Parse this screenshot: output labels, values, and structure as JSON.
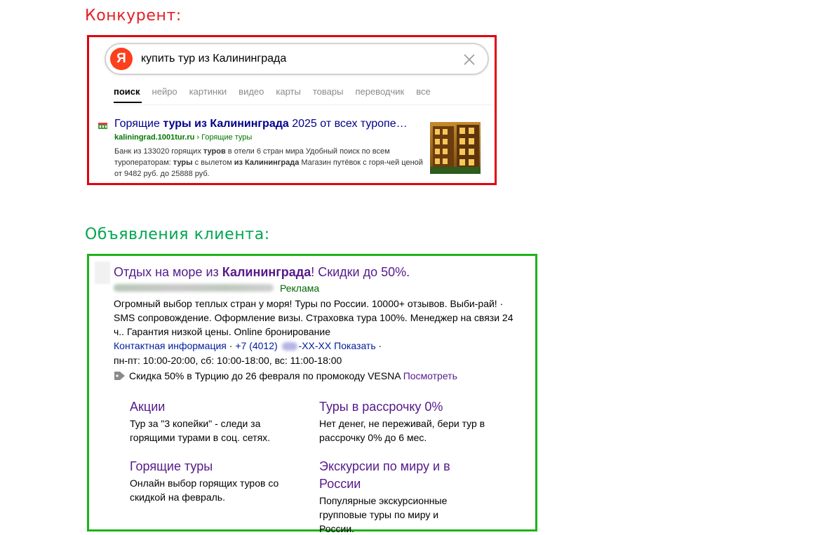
{
  "headings": {
    "competitor": "Конкурент:",
    "client": "Объявления клиента:"
  },
  "competitor": {
    "search": {
      "logo": "Я",
      "query": "купить тур из Калининграда"
    },
    "tabs": [
      "поиск",
      "нейро",
      "картинки",
      "видео",
      "карты",
      "товары",
      "переводчик",
      "все"
    ],
    "result": {
      "title_pre": "Горящие ",
      "title_bold": "туры из Калининграда",
      "title_post": " 2025 от всех туропе…",
      "url_domain": "kaliningrad.1001tur.ru",
      "url_path": " › Горящие туры",
      "desc_1": "Банк из 133020 горящих ",
      "desc_b1": "туров",
      "desc_2": " в отели 6 стран мира Удобный поиск по всем туроператорам: ",
      "desc_b2": "туры",
      "desc_3": " с вылетом ",
      "desc_b3": "из Калининграда",
      "desc_4": " Магазин путёвок с горя-чей ценой от 9482 руб. до 25888 руб."
    }
  },
  "client_ad": {
    "title_pre": "Отдых на море из ",
    "title_bold": "Калининграда",
    "title_post": "! Скидки до 50%.",
    "label": "Реклама",
    "description": "Огромный выбор теплых стран у моря! Туры по России. 10000+ отзывов. Выби-рай! · SMS сопровождение. Оформление визы. Страховка тура 100%. Менеджер на связи 24 ч.. Гарантия низкой цены. Online бронирование",
    "contacts": {
      "contact_info": "Контактная информация",
      "sep": " · ",
      "phone_start": "+7 (4012) ",
      "phone_end": "-XX-XX",
      "show": "Показать",
      "sep_end": " ·"
    },
    "hours": "пн-пт: 10:00-20:00, сб: 10:00-18:00, вс: 11:00-18:00",
    "promo": {
      "text": "Скидка 50% в Турцию до 26 февраля по промокоду VESNA ",
      "link": "Посмотреть"
    },
    "sitelinks": [
      {
        "title": "Акции",
        "desc": "Тур за \"3 копейки\" - следи за горящими турами в соц. сетях."
      },
      {
        "title": "Туры в рассрочку 0%",
        "desc": "Нет денег, не переживай, бери тур в рассрочку 0% до 6 мес."
      },
      {
        "title": "Горящие туры",
        "desc": "Онлайн выбор горящих туров со скидкой на февраль."
      },
      {
        "title": "Экскурсии по миру и в России",
        "desc": "Популярные экскурсионные групповые туры по миру и России."
      }
    ]
  },
  "colors": {
    "competitor_border": "#e3000f",
    "client_border": "#1db319",
    "link_title": "#00008b",
    "ad_title": "#551a8b",
    "url_green": "#007700"
  }
}
